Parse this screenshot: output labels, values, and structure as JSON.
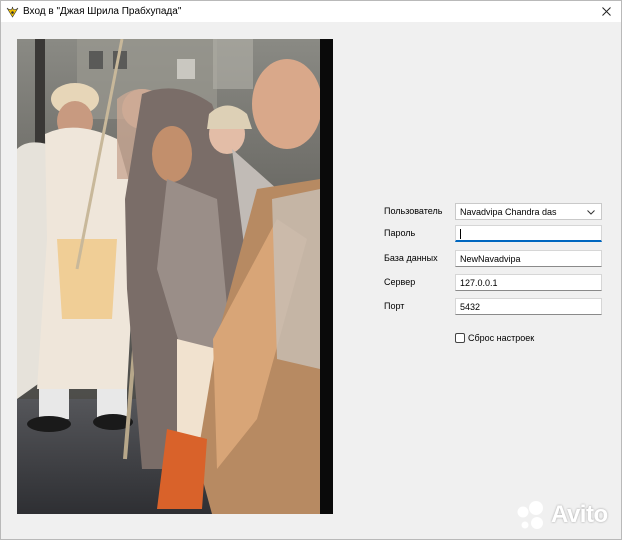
{
  "window": {
    "title": "Вход в \"Джая Шрила Прабхупада\""
  },
  "form": {
    "user": {
      "label": "Пользователь",
      "value": "Navadvipa Chandra das"
    },
    "password": {
      "label": "Пароль",
      "value": ""
    },
    "database": {
      "label": "База данных",
      "value": "NewNavadvipa"
    },
    "server": {
      "label": "Сервер",
      "value": "127.0.0.1"
    },
    "port": {
      "label": "Порт",
      "value": "5432"
    },
    "reset": {
      "label": "Сброс настроек",
      "checked": false
    }
  },
  "photo": {
    "description": "photograph"
  },
  "watermark": {
    "text": "Avito"
  },
  "colors": {
    "focus_accent": "#0067c0",
    "photo_frame": "#0a0a0a",
    "window_bg": "#f0f0f0"
  },
  "icons": [
    "app-logo-icon",
    "close-icon",
    "chevron-down-icon"
  ]
}
